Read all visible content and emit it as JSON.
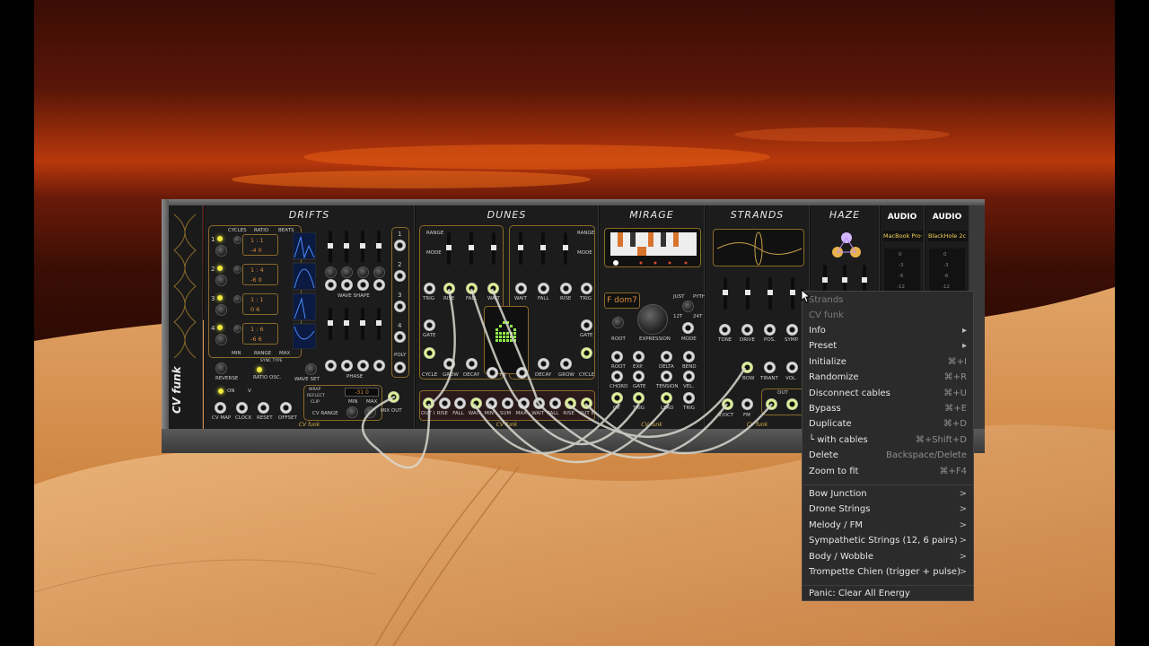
{
  "modules": {
    "drifts": {
      "title": "DRIFTS",
      "labels": {
        "cycles": "CYCLES",
        "ratio": "RATIO",
        "beats": "BEATS",
        "min": "MIN",
        "range": "RANGE",
        "max": "MAX",
        "wave_shape": "WAVE SHAPE",
        "reverse": "REVERSE",
        "sync_type": "SYNC TYPE",
        "ratio_osc": "RATIO OSC.",
        "wave_set": "WAVE SET",
        "phase": "PHASE",
        "poly": "POLY",
        "on": "ON",
        "v": "V",
        "cv_map": "CV MAP",
        "clock": "CLOCK",
        "reset": "RESET",
        "offset": "OFFSET",
        "wrap": "WRAP",
        "reflect": "REFLECT",
        "clip": "CLIP",
        "cv_range": "CV RANGE",
        "range_min": "MIN",
        "range_max": "MAX",
        "mix_out": "MIX OUT",
        "range_val": "-31  0"
      },
      "ratio_rows": [
        {
          "index": "1",
          "ratio": "1 : 1",
          "beats": "-4   0"
        },
        {
          "index": "2",
          "ratio": "1 : 4",
          "beats": "-6   0"
        },
        {
          "index": "3",
          "ratio": "1 : 1",
          "beats": "0   6"
        },
        {
          "index": "4",
          "ratio": "1 : 6",
          "beats": "-6   6"
        }
      ],
      "out_numbers": [
        "1",
        "2",
        "3",
        "4"
      ],
      "brand": "CV funk",
      "side_label": "CV funk"
    },
    "dunes": {
      "title": "DUNES",
      "labels": {
        "range": "RANGE",
        "mode": "MODE",
        "trig": "TRIG",
        "rise": "RISE",
        "fall": "FALL",
        "wait": "WAIT",
        "gate": "GATE",
        "cycle": "CYCLE",
        "grow": "GROW",
        "decay": "DECAY",
        "i": "I",
        "ii": "II"
      },
      "bottom_labels": [
        "OUT I",
        "RISE",
        "FALL",
        "WAIT",
        "MIN",
        "SUM",
        "MAX",
        "WAIT",
        "FALL",
        "RISE",
        "OUT II"
      ],
      "brand": "CV funk"
    },
    "mirage": {
      "title": "MIRAGE",
      "chord": "F dom7",
      "labels": {
        "just": "JUST",
        "pyth": "PYTH",
        "t12": "12T",
        "t24": "24T",
        "root": "ROOT",
        "expression": "EXPRESSION",
        "mode": "MODE",
        "exp": "EXP.",
        "delta": "DELTA",
        "bend": "BEND",
        "chord": "CHORD",
        "gate": "GATE",
        "tension": "TENSION",
        "vel": "VEL.",
        "cv": "CV",
        "trig": "TRIG",
        "lead": "LEAD"
      },
      "brand": "CV funk"
    },
    "strands": {
      "title": "STRANDS",
      "labels": {
        "tone": "TONE",
        "drive": "DRIVE",
        "pos": "POS.",
        "symp": "SYMP.",
        "bow": "BOW",
        "tirant": "TIRANT",
        "vol": "VOL.",
        "voct": "V/OCT",
        "fm": "FM",
        "out": "OUT"
      },
      "brand": "CV funk"
    },
    "haze": {
      "title": "HAZE"
    },
    "audio": {
      "titles": [
        "AUDIO",
        "AUDIO"
      ],
      "devices": [
        "MacBook Pro·",
        "BlackHole 2c"
      ],
      "meter": [
        "0",
        "-3",
        "-6",
        "-12"
      ]
    }
  },
  "context_menu": {
    "header": "Strands",
    "subheader": "CV funk",
    "items": [
      {
        "label": "Info",
        "arrow": "▸"
      },
      {
        "label": "Preset",
        "arrow": "▸"
      },
      {
        "label": "Initialize",
        "shortcut": "⌘+I"
      },
      {
        "label": "Randomize",
        "shortcut": "⌘+R"
      },
      {
        "label": "Disconnect cables",
        "shortcut": "⌘+U"
      },
      {
        "label": "Bypass",
        "shortcut": "⌘+E"
      },
      {
        "label": "Duplicate",
        "shortcut": "⌘+D"
      },
      {
        "label": "└ with cables",
        "shortcut": "⌘+Shift+D"
      },
      {
        "label": "Delete",
        "shortcut": "Backspace/Delete"
      },
      {
        "label": "Zoom to fit",
        "shortcut": "⌘+F4"
      }
    ],
    "presets": [
      {
        "label": "Bow Junction",
        "arrow": ">"
      },
      {
        "label": "Drone Strings",
        "arrow": ">"
      },
      {
        "label": "Melody / FM",
        "arrow": ">"
      },
      {
        "label": "Sympathetic Strings (12, 6 pairs)",
        "arrow": ">"
      },
      {
        "label": "Body / Wobble",
        "arrow": ">"
      },
      {
        "label": "Trompette Chien (trigger + pulse)",
        "arrow": ">"
      }
    ],
    "panic": "Panic: Clear All Energy"
  },
  "colors": {
    "panel": "#1c1c1c",
    "accent_gold": "#d8b24a",
    "led_yellow": "#f2ea3e",
    "menu_bg": "#2b2b2b"
  }
}
